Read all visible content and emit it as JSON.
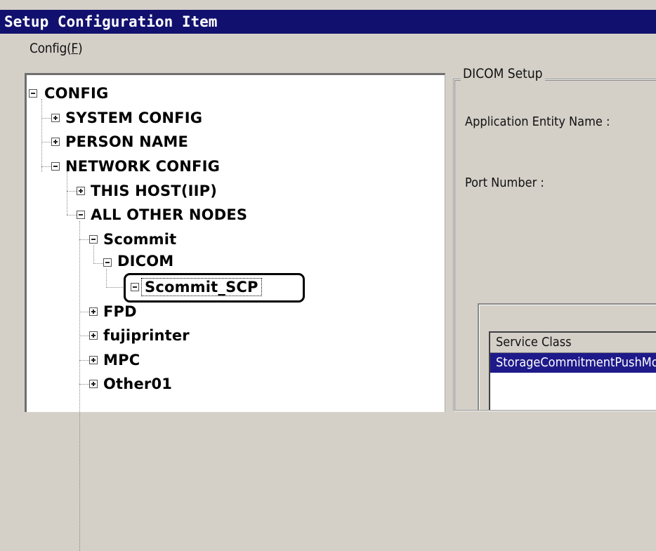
{
  "window": {
    "title": "Setup Configuration Item"
  },
  "menu": {
    "items": [
      {
        "label": "Config(",
        "accel": "F",
        "suffix": ")"
      }
    ]
  },
  "tree": {
    "nodes": [
      {
        "label": "CONFIG",
        "state": "expanded"
      },
      {
        "label": "SYSTEM CONFIG",
        "state": "collapsed"
      },
      {
        "label": "PERSON NAME",
        "state": "collapsed"
      },
      {
        "label": "NETWORK CONFIG",
        "state": "expanded"
      },
      {
        "label": "THIS HOST(IIP)",
        "state": "collapsed"
      },
      {
        "label": "ALL OTHER NODES",
        "state": "expanded"
      },
      {
        "label": "Scommit",
        "state": "expanded"
      },
      {
        "label": "DICOM",
        "state": "expanded"
      },
      {
        "label": "Scommit_SCP",
        "state": "expanded",
        "selected": true
      },
      {
        "label": "FPD",
        "state": "collapsed"
      },
      {
        "label": "fujiprinter",
        "state": "collapsed"
      },
      {
        "label": "MPC",
        "state": "collapsed"
      },
      {
        "label": "Other01",
        "state": "collapsed"
      }
    ]
  },
  "dicom_setup": {
    "group_title": "DICOM Setup",
    "ae_name_label": "Application Entity Name :",
    "port_label": "Port Number :",
    "service_list": {
      "header": "Service Class",
      "rows": [
        "StorageCommitmentPushModel"
      ]
    }
  },
  "colors": {
    "titlebar": "#12106e",
    "selection": "#1f1a8a",
    "background": "#d4d0c8"
  }
}
